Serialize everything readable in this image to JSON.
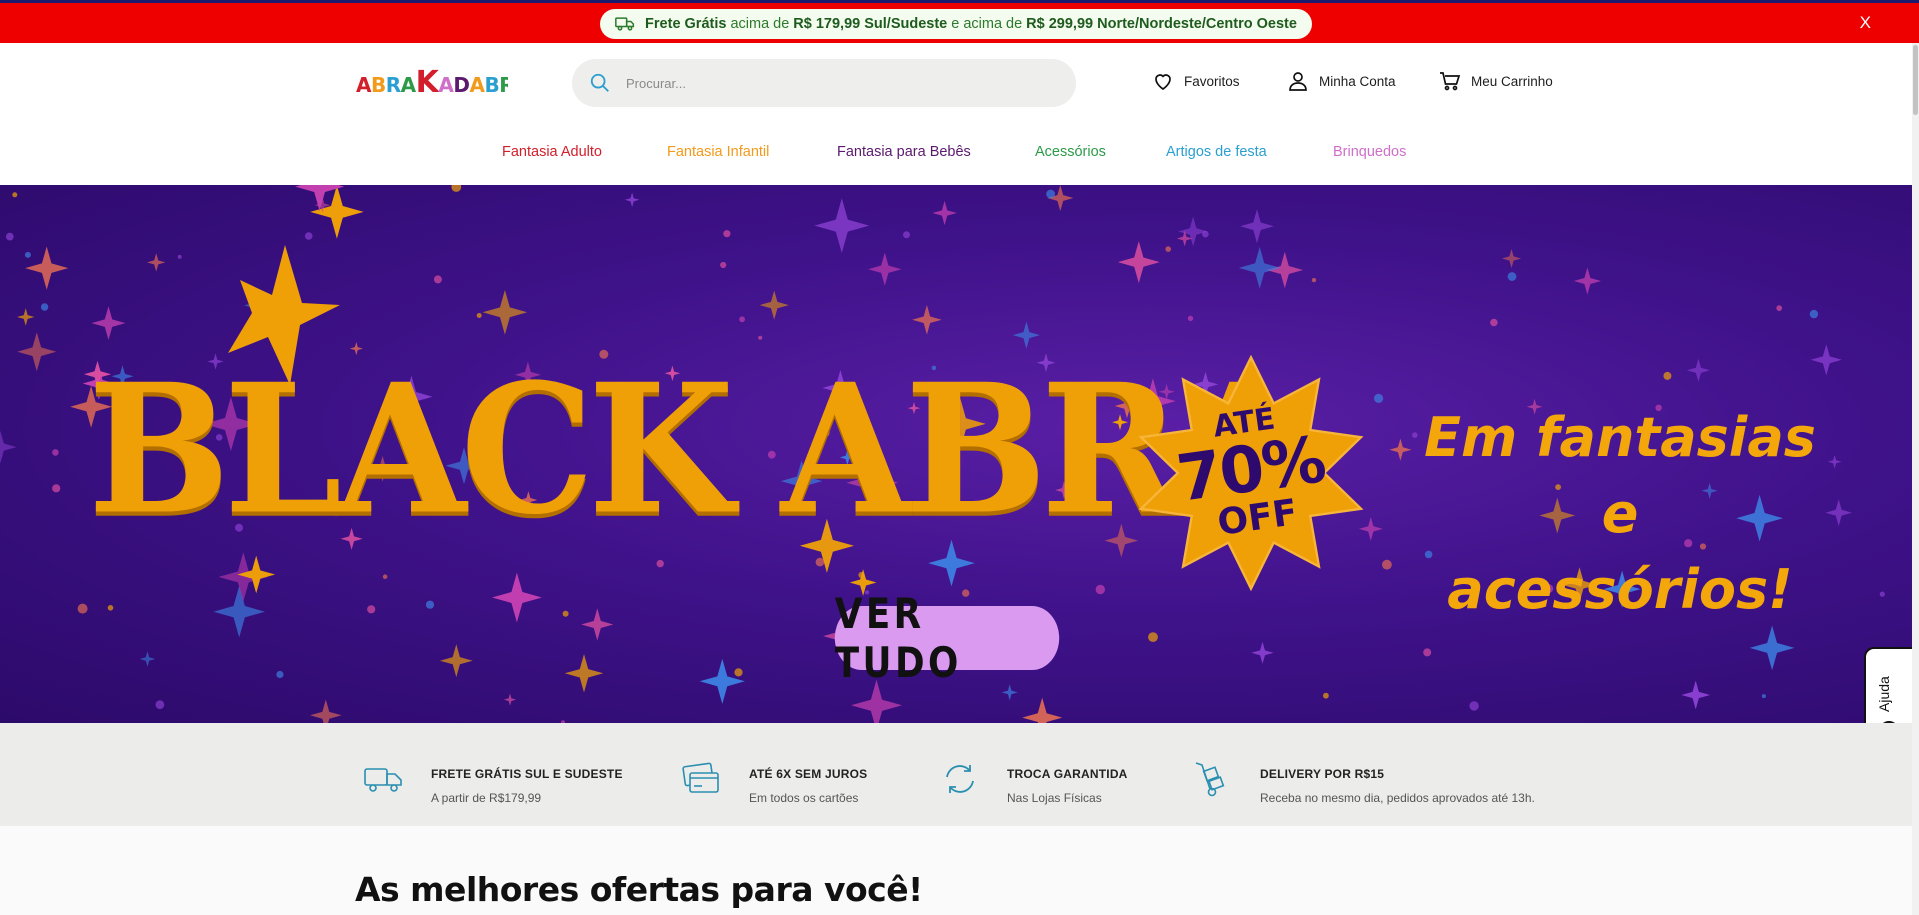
{
  "topbar": {
    "free_label": "Frete Grátis",
    "text_1": "acima de",
    "amount_1": "R$ 179,99 Sul/Sudeste",
    "text_2": "e acima de",
    "amount_2": "R$ 299,99 Norte/Nordeste/Centro Oeste",
    "close_label": "X",
    "background_color": "#ee0000"
  },
  "header": {
    "logo_text": "ABRAKADABRA",
    "search_placeholder": "Procurar...",
    "favorites_label": "Favoritos",
    "account_label": "Minha Conta",
    "cart_label": "Meu Carrinho"
  },
  "categories": [
    {
      "label": "Fantasia Adulto",
      "color": "#d21f2b"
    },
    {
      "label": "Fantasia Infantil",
      "color": "#f29a1b"
    },
    {
      "label": "Fantasia para Bebês",
      "color": "#5b1a6e"
    },
    {
      "label": "Acessórios",
      "color": "#2c9a48"
    },
    {
      "label": "Artigos de festa",
      "color": "#2a9fd0"
    },
    {
      "label": "Brinquedos",
      "color": "#cf6fc9"
    }
  ],
  "banner": {
    "headline": "BLACK ABRA",
    "badge_line_1": "ATÉ",
    "badge_line_2": "70%",
    "badge_line_3": "OFF",
    "offer_line_1": "Em fantasias e",
    "offer_line_2": "acessórios!",
    "cta_label": "VER TUDO",
    "accent_color": "#f0a007",
    "background_color": "#3f128a"
  },
  "help": {
    "label": "Ajuda",
    "icon": "question-icon"
  },
  "benefits": [
    {
      "title": "FRETE GRÁTIS SUL E SUDESTE",
      "subtitle": "A partir de R$179,99",
      "icon": "truck-icon"
    },
    {
      "title": "ATÉ 6X SEM JUROS",
      "subtitle": "Em todos os cartões",
      "icon": "credit-card-icon"
    },
    {
      "title": "TROCA GARANTIDA",
      "subtitle": "Nas Lojas Físicas",
      "icon": "exchange-icon"
    },
    {
      "title": "DELIVERY POR R$15",
      "subtitle": "Receba no mesmo dia, pedidos aprovados até 13h.",
      "icon": "hand-truck-icon"
    }
  ],
  "section": {
    "title": "As melhores ofertas para você!"
  }
}
